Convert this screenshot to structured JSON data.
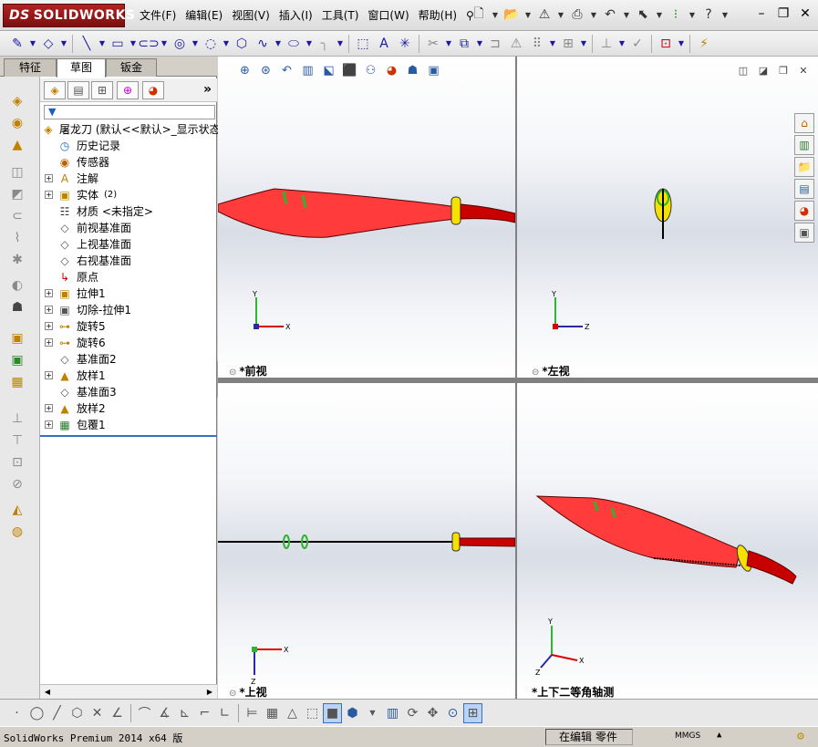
{
  "app": {
    "logo": "SOLIDWORKS",
    "logo_prefix": "DS"
  },
  "menus": [
    "文件(F)",
    "编辑(E)",
    "视图(V)",
    "插入(I)",
    "工具(T)",
    "窗口(W)",
    "帮助(H)"
  ],
  "fm_tabs": [
    "特征",
    "草图",
    "钣金"
  ],
  "active_tab": "草图",
  "tree": [
    {
      "label": "屠龙刀  (默认<<默认>_显示状态",
      "icon": "part-icon",
      "expand": false,
      "indent": 0
    },
    {
      "label": "历史记录",
      "icon": "history-icon",
      "expand": false,
      "indent": 1
    },
    {
      "label": "传感器",
      "icon": "sensor-icon",
      "expand": false,
      "indent": 1
    },
    {
      "label": "注解",
      "icon": "annotation-icon",
      "expand": true,
      "indent": 1
    },
    {
      "label": "实体",
      "suffix": "(2)",
      "icon": "solid-body-icon",
      "expand": true,
      "indent": 1
    },
    {
      "label": "材质 <未指定>",
      "icon": "material-icon",
      "expand": false,
      "indent": 1
    },
    {
      "label": "前视基准面",
      "icon": "plane-icon",
      "expand": false,
      "indent": 1
    },
    {
      "label": "上视基准面",
      "icon": "plane-icon",
      "expand": false,
      "indent": 1
    },
    {
      "label": "右视基准面",
      "icon": "plane-icon",
      "expand": false,
      "indent": 1
    },
    {
      "label": "原点",
      "icon": "origin-icon",
      "expand": false,
      "indent": 1
    },
    {
      "label": "拉伸1",
      "icon": "extrude-icon",
      "expand": true,
      "indent": 1
    },
    {
      "label": "切除-拉伸1",
      "icon": "cut-extrude-icon",
      "expand": true,
      "indent": 1
    },
    {
      "label": "旋转5",
      "icon": "revolve-icon",
      "expand": true,
      "indent": 1
    },
    {
      "label": "旋转6",
      "icon": "revolve-icon",
      "expand": true,
      "indent": 1
    },
    {
      "label": "基准面2",
      "icon": "plane-icon",
      "expand": false,
      "indent": 1
    },
    {
      "label": "放样1",
      "icon": "loft-icon",
      "expand": true,
      "indent": 1
    },
    {
      "label": "基准面3",
      "icon": "plane-icon",
      "expand": false,
      "indent": 1
    },
    {
      "label": "放样2",
      "icon": "loft-icon",
      "expand": true,
      "indent": 1
    },
    {
      "label": "包覆1",
      "icon": "wrap-icon",
      "expand": true,
      "indent": 1
    }
  ],
  "viewports": [
    {
      "id": "front",
      "label": "*前视",
      "axes": [
        "Y",
        "X"
      ]
    },
    {
      "id": "left",
      "label": "*左视",
      "axes": [
        "Y",
        "Z"
      ]
    },
    {
      "id": "top",
      "label": "*上视",
      "axes": [
        "X",
        "Z"
      ]
    },
    {
      "id": "iso",
      "label": "*上下二等角轴测",
      "axes": [
        "Y",
        "X",
        "Z"
      ]
    }
  ],
  "colors": {
    "blade": "#ff3b3b",
    "guard": "#f5e000",
    "grip": "#c80000",
    "ring": "#2db52d"
  },
  "status": {
    "product": "SolidWorks Premium 2014 x64 版",
    "mode": "在编辑 零件",
    "units": "MMGS"
  }
}
